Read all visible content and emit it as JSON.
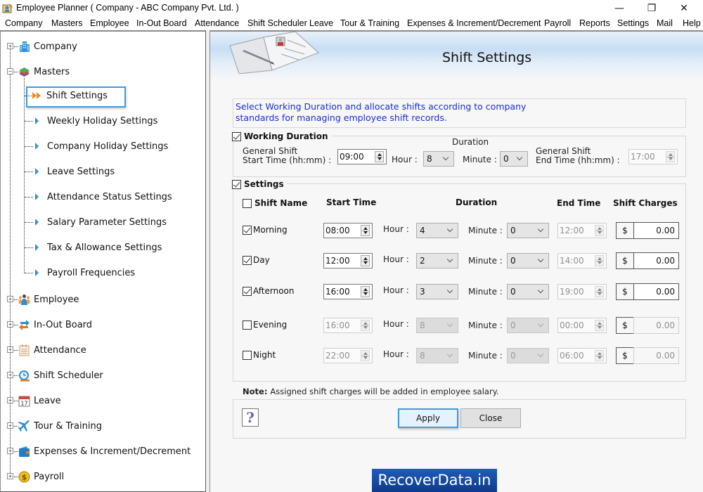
{
  "window": {
    "title": "Employee Planner ( Company - ABC Company Pvt. Ltd. )",
    "controls": {
      "minimize": "—",
      "maximize": "❐",
      "close": "✕"
    }
  },
  "menu": [
    "Company",
    "Masters",
    "Employee",
    "In-Out Board",
    "Attendance",
    "Shift Scheduler",
    "Leave",
    "Tour & Training",
    "Expenses & Increment/Decrement",
    "Payroll",
    "Reports",
    "Settings",
    "Mail",
    "Help"
  ],
  "sidebar": {
    "nodes": [
      {
        "label": "Company",
        "icon": "building-icon",
        "expander": "+"
      },
      {
        "label": "Masters",
        "icon": "layers-icon",
        "expander": "−",
        "children": [
          {
            "label": "Shift Settings",
            "selected": true
          },
          {
            "label": "Weekly Holiday Settings"
          },
          {
            "label": "Company Holiday Settings"
          },
          {
            "label": "Leave Settings"
          },
          {
            "label": "Attendance Status Settings"
          },
          {
            "label": "Salary Parameter Settings"
          },
          {
            "label": "Tax & Allowance Settings"
          },
          {
            "label": "Payroll Frequencies"
          }
        ]
      },
      {
        "label": "Employee",
        "icon": "employees-icon",
        "expander": "+"
      },
      {
        "label": "In-Out Board",
        "icon": "swap-arrows-icon",
        "expander": "+"
      },
      {
        "label": "Attendance",
        "icon": "clipboard-icon",
        "expander": "+"
      },
      {
        "label": "Shift Scheduler",
        "icon": "clock-icon",
        "expander": "+"
      },
      {
        "label": "Leave",
        "icon": "calendar-icon",
        "expander": "+",
        "icon_text": "17"
      },
      {
        "label": "Tour & Training",
        "icon": "airplane-icon",
        "expander": "+"
      },
      {
        "label": "Expenses & Increment/Decrement",
        "icon": "wallet-icon",
        "expander": "+"
      },
      {
        "label": "Payroll",
        "icon": "dollar-coin-icon",
        "expander": "+",
        "icon_text": "$"
      }
    ]
  },
  "main": {
    "title": "Shift Settings",
    "intro": "Select Working Duration and allocate shifts according to company standards for managing employee shift records.",
    "working_duration": {
      "label": "Working Duration",
      "checked": true,
      "duration_label": "Duration",
      "start_label_1": "General Shift",
      "start_label_2": "Start Time (hh:mm) :",
      "start_time": "09:00",
      "hour_label": "Hour :",
      "hour": "8",
      "minute_label": "Minute :",
      "minute": "0",
      "end_label_1": "General Shift",
      "end_label_2": "End Time (hh:mm) :",
      "end_time": "17:00"
    },
    "settings": {
      "label": "Settings",
      "checked": true,
      "columns": {
        "shift_name": "Shift Name",
        "start_time": "Start Time",
        "duration": "Duration",
        "end_time": "End Time",
        "shift_charges": "Shift Charges"
      },
      "hour_label": "Hour :",
      "minute_label": "Minute :",
      "currency": "$",
      "shifts": [
        {
          "name": "Morning",
          "checked": true,
          "start": "08:00",
          "hour": "4",
          "minute": "0",
          "end": "12:00",
          "charge": "0.00"
        },
        {
          "name": "Day",
          "checked": true,
          "start": "12:00",
          "hour": "2",
          "minute": "0",
          "end": "14:00",
          "charge": "0.00"
        },
        {
          "name": "Afternoon",
          "checked": true,
          "start": "16:00",
          "hour": "3",
          "minute": "0",
          "end": "19:00",
          "charge": "0.00"
        },
        {
          "name": "Evening",
          "checked": false,
          "start": "16:00",
          "hour": "8",
          "minute": "0",
          "end": "00:00",
          "charge": "0.00"
        },
        {
          "name": "Night",
          "checked": false,
          "start": "22:00",
          "hour": "8",
          "minute": "0",
          "end": "06:00",
          "charge": "0.00"
        }
      ]
    },
    "note_label": "Note:",
    "note_text": "Assigned shift charges will be added in employee salary.",
    "buttons": {
      "help": "?",
      "apply": "Apply",
      "close": "Close"
    },
    "watermark": "RecoverData.in"
  },
  "colors": {
    "intro_text": "#1a2fd0",
    "selection_border": "#3c9be0",
    "tree_arrow": "#2f8fd8",
    "selected_arrow": "#f08a1e"
  }
}
